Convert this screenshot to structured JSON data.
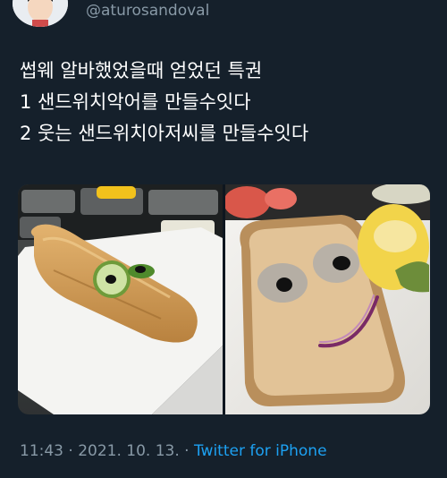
{
  "author": {
    "handle": "@aturosandoval"
  },
  "tweet": {
    "lines": [
      "썹웨 알바했었을때 얻었던 특권",
      "1 샌드위치악어를 만들수잇다",
      "2 웃는 샌드위치아저씨를 만들수잇다"
    ]
  },
  "meta": {
    "time": "11:43",
    "sep1": " · ",
    "date": "2021. 10. 13.",
    "sep2": " · ",
    "source": "Twitter for iPhone"
  },
  "colors": {
    "background": "#15202b",
    "text": "#ffffff",
    "muted": "#8899a6",
    "link": "#1da1f2"
  }
}
